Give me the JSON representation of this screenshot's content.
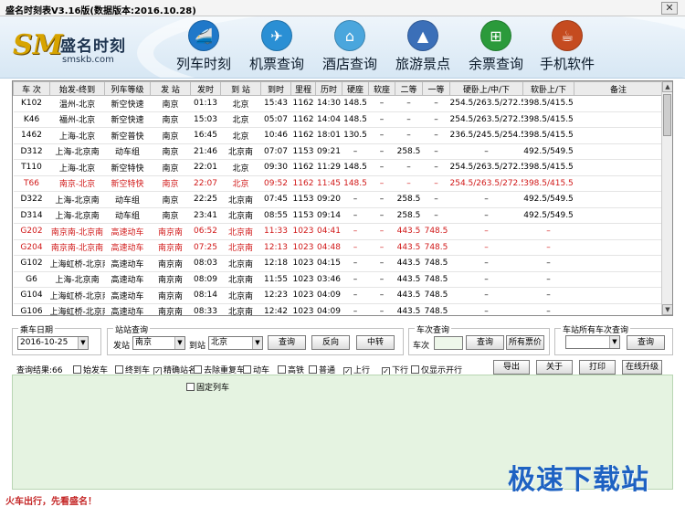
{
  "window": {
    "title": "盛名时刻表V3.16版(数据版本:2016.10.28)",
    "close_glyph": "✕"
  },
  "brand": {
    "logo": "SM",
    "name": "盛名时刻",
    "domain": "smskb.com"
  },
  "nav": [
    {
      "label": "列车时刻",
      "icon": "train-icon",
      "color": "#1f78c9"
    },
    {
      "label": "机票查询",
      "icon": "plane-icon",
      "color": "#2a8fd4"
    },
    {
      "label": "酒店查询",
      "icon": "hotel-icon",
      "color": "#4aa6dd"
    },
    {
      "label": "旅游景点",
      "icon": "landmark-icon",
      "color": "#3b6fb8"
    },
    {
      "label": "余票查询",
      "icon": "windows-logo-icon",
      "color": "#2b9a3b"
    },
    {
      "label": "手机软件",
      "icon": "java-icon",
      "color": "#c54b1f"
    }
  ],
  "table": {
    "columns": [
      "车 次",
      "始发-终到",
      "列车等级",
      "发 站",
      "发时",
      "到 站",
      "到时",
      "里程",
      "历时",
      "硬座",
      "软座",
      "二等",
      "一等",
      "硬卧上/中/下",
      "软卧上/下",
      "备注"
    ],
    "rows": [
      {
        "red": false,
        "cells": [
          "K102",
          "温州-北京",
          "新空快速",
          "南京",
          "01:13",
          "北京",
          "15:43",
          "1162",
          "14:30",
          "148.5",
          "–",
          "–",
          "–",
          "254.5/263.5/272.5",
          "398.5/415.5",
          ""
        ]
      },
      {
        "red": false,
        "cells": [
          "K46",
          "福州-北京",
          "新空快速",
          "南京",
          "15:03",
          "北京",
          "05:07",
          "1162",
          "14:04",
          "148.5",
          "–",
          "–",
          "–",
          "254.5/263.5/272.5",
          "398.5/415.5",
          ""
        ]
      },
      {
        "red": false,
        "cells": [
          "1462",
          "上海-北京",
          "新空普快",
          "南京",
          "16:45",
          "北京",
          "10:46",
          "1162",
          "18:01",
          "130.5",
          "–",
          "–",
          "–",
          "236.5/245.5/254.5",
          "398.5/415.5",
          ""
        ]
      },
      {
        "red": false,
        "cells": [
          "D312",
          "上海-北京南",
          "动车组",
          "南京",
          "21:46",
          "北京南",
          "07:07",
          "1153",
          "09:21",
          "–",
          "–",
          "258.5",
          "–",
          "–",
          "492.5/549.5",
          ""
        ]
      },
      {
        "red": false,
        "cells": [
          "T110",
          "上海-北京",
          "新空特快",
          "南京",
          "22:01",
          "北京",
          "09:30",
          "1162",
          "11:29",
          "148.5",
          "–",
          "–",
          "–",
          "254.5/263.5/272.5",
          "398.5/415.5",
          ""
        ]
      },
      {
        "red": true,
        "cells": [
          "T66",
          "南京-北京",
          "新空特快",
          "南京",
          "22:07",
          "北京",
          "09:52",
          "1162",
          "11:45",
          "148.5",
          "–",
          "–",
          "–",
          "254.5/263.5/272.5",
          "398.5/415.5",
          ""
        ]
      },
      {
        "red": false,
        "cells": [
          "D322",
          "上海-北京南",
          "动车组",
          "南京",
          "22:25",
          "北京南",
          "07:45",
          "1153",
          "09:20",
          "–",
          "–",
          "258.5",
          "–",
          "–",
          "492.5/549.5",
          ""
        ]
      },
      {
        "red": false,
        "cells": [
          "D314",
          "上海-北京南",
          "动车组",
          "南京",
          "23:41",
          "北京南",
          "08:55",
          "1153",
          "09:14",
          "–",
          "–",
          "258.5",
          "–",
          "–",
          "492.5/549.5",
          ""
        ]
      },
      {
        "red": true,
        "cells": [
          "G202",
          "南京南-北京南",
          "高速动车",
          "南京南",
          "06:52",
          "北京南",
          "11:33",
          "1023",
          "04:41",
          "–",
          "–",
          "443.5",
          "748.5",
          "–",
          "–",
          ""
        ]
      },
      {
        "red": true,
        "cells": [
          "G204",
          "南京南-北京南",
          "高速动车",
          "南京南",
          "07:25",
          "北京南",
          "12:13",
          "1023",
          "04:48",
          "–",
          "–",
          "443.5",
          "748.5",
          "–",
          "–",
          ""
        ]
      },
      {
        "red": false,
        "cells": [
          "G102",
          "上海虹桥-北京南",
          "高速动车",
          "南京南",
          "08:03",
          "北京南",
          "12:18",
          "1023",
          "04:15",
          "–",
          "–",
          "443.5",
          "748.5",
          "–",
          "–",
          ""
        ]
      },
      {
        "red": false,
        "cells": [
          "G6",
          "上海-北京南",
          "高速动车",
          "南京南",
          "08:09",
          "北京南",
          "11:55",
          "1023",
          "03:46",
          "–",
          "–",
          "443.5",
          "748.5",
          "–",
          "–",
          ""
        ]
      },
      {
        "red": false,
        "cells": [
          "G104",
          "上海虹桥-北京南",
          "高速动车",
          "南京南",
          "08:14",
          "北京南",
          "12:23",
          "1023",
          "04:09",
          "–",
          "–",
          "443.5",
          "748.5",
          "–",
          "–",
          ""
        ]
      },
      {
        "red": false,
        "cells": [
          "G106",
          "上海虹桥-北京南",
          "高速动车",
          "南京南",
          "08:33",
          "北京南",
          "12:42",
          "1023",
          "04:09",
          "–",
          "–",
          "443.5",
          "748.5",
          "–",
          "–",
          ""
        ]
      }
    ]
  },
  "controls": {
    "date_group": "乘车日期",
    "date_value": "2016-10-25",
    "station_group": "站站查询",
    "from_label": "发站",
    "from_value": "南京",
    "to_label": "到站",
    "to_value": "北京",
    "btn_query": "查询",
    "btn_reverse": "反向",
    "btn_transfer": "中转",
    "train_group": "车次查询",
    "train_label": "车次",
    "btn_train_query": "查询",
    "btn_all_prices": "所有票价",
    "station_all_group": "车站所有车次查询",
    "btn_station_query": "查询"
  },
  "filters": {
    "result_label": "查询结果:66",
    "items": [
      {
        "label": "始发车",
        "checked": false
      },
      {
        "label": "终到车",
        "checked": false
      },
      {
        "label": "精确站名",
        "checked": true
      },
      {
        "label": "去除重复车",
        "checked": false
      },
      {
        "label": "动车",
        "checked": false
      },
      {
        "label": "高铁",
        "checked": false
      },
      {
        "label": "普通",
        "checked": false
      },
      {
        "label": "上行",
        "checked": true
      },
      {
        "label": "下行",
        "checked": true
      },
      {
        "label": "仅显示开行",
        "checked": false
      }
    ],
    "fixed_train": "固定列车",
    "btn_export": "导出",
    "btn_about": "关于",
    "btn_print": "打印",
    "btn_upgrade": "在线升级"
  },
  "status": "火车出行，先看盛名！",
  "watermark": "极速下载站"
}
